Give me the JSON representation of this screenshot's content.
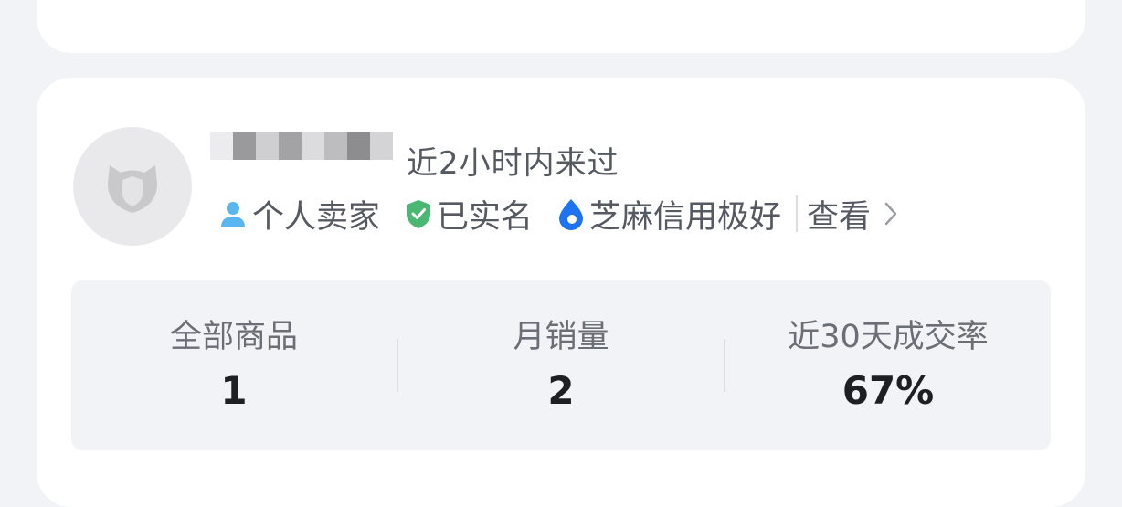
{
  "seller": {
    "last_seen": "近2小时内来过",
    "tags": [
      {
        "label": "个人卖家",
        "icon": "person-icon",
        "color": "#5bb6ef"
      },
      {
        "label": "已实名",
        "icon": "verified-shield-icon",
        "color": "#4ab873"
      },
      {
        "label": "芝麻信用极好",
        "icon": "sesame-credit-icon",
        "color": "#1e73f0"
      }
    ],
    "view_label": "查看"
  },
  "stats": [
    {
      "label": "全部商品",
      "value": "1"
    },
    {
      "label": "月销量",
      "value": "2"
    },
    {
      "label": "近30天成交率",
      "value": "67%"
    }
  ]
}
